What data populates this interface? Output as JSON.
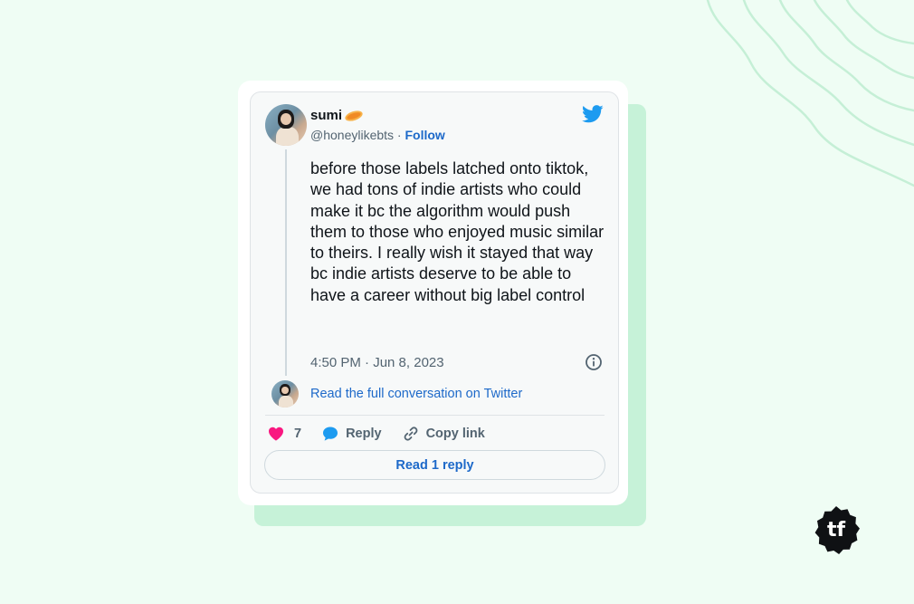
{
  "tweet": {
    "author_name": "sumi",
    "handle": "@honeylikebts",
    "separator": " · ",
    "follow_label": "Follow",
    "text": "before those labels latched onto tiktok, we had tons of indie artists who could make it bc the algorithm would push them to those who enjoyed music similar to theirs. I really wish it stayed that way bc indie artists deserve to be able to have a career without big label control",
    "timestamp": "4:50 PM · Jun 8, 2023",
    "read_conversation_label": "Read the full conversation on Twitter",
    "like_count": "7",
    "reply_label": "Reply",
    "copy_link_label": "Copy link",
    "read_reply_label": "Read 1 reply"
  },
  "badge": {
    "text": "tf"
  },
  "colors": {
    "background": "#effdf4",
    "accent_green": "#c6f2d8",
    "twitter_blue": "#1d9bf0",
    "link_blue": "#1d69c9",
    "like_pink": "#f91880",
    "text_primary": "#0f1419",
    "text_secondary": "#536471"
  },
  "icons": [
    "twitter-bird",
    "info-circle",
    "heart",
    "speech-bubble",
    "link-chain"
  ]
}
